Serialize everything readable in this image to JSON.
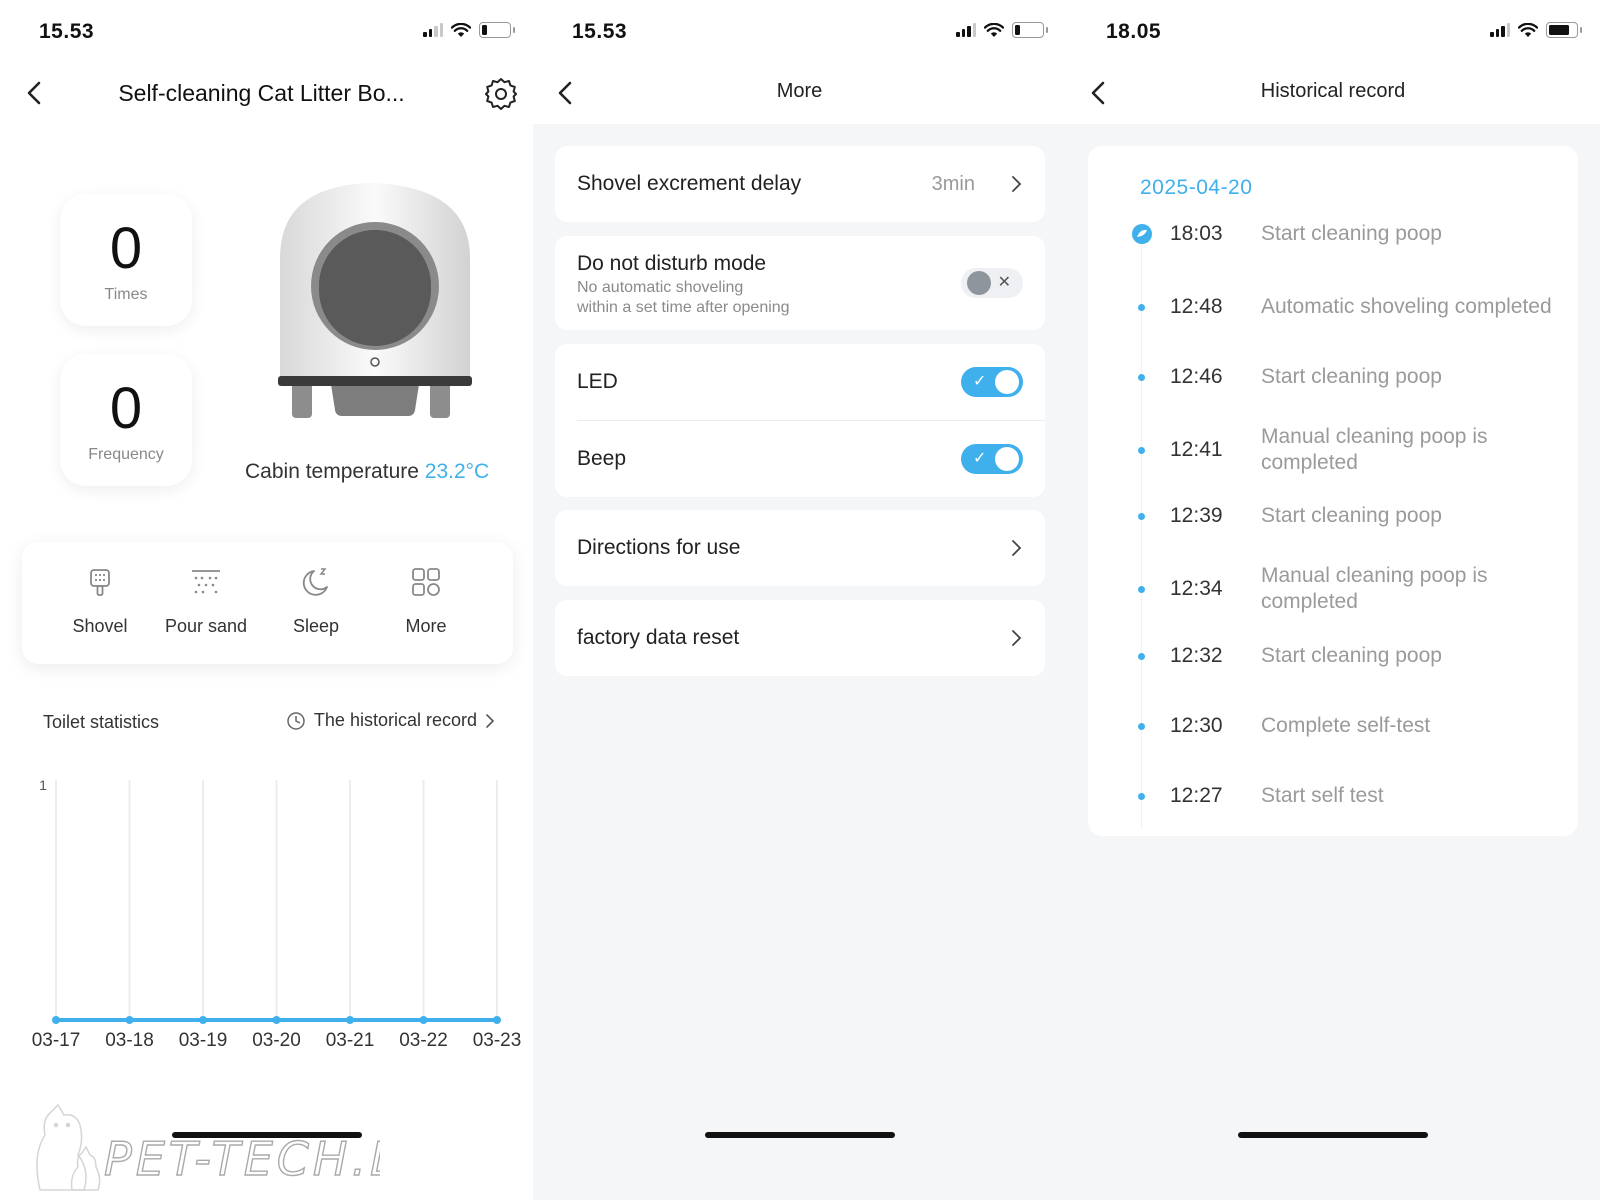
{
  "screen1": {
    "status_time": "15.53",
    "title": "Self-cleaning Cat Litter Bo...",
    "times": {
      "value": "0",
      "label": "Times"
    },
    "frequency": {
      "value": "0",
      "label": "Frequency"
    },
    "cabin_label": "Cabin temperature",
    "cabin_temp": "23.2°C",
    "actions": [
      {
        "label": "Shovel",
        "icon": "shovel-icon"
      },
      {
        "label": "Pour sand",
        "icon": "pour-sand-icon"
      },
      {
        "label": "Sleep",
        "icon": "moon-icon"
      },
      {
        "label": "More",
        "icon": "grid-icon"
      }
    ],
    "stats_title": "Toilet statistics",
    "history_link": "The historical record",
    "watermark": "PET-TECH.DK"
  },
  "chart_data": {
    "type": "line",
    "categories": [
      "03-17",
      "03-18",
      "03-19",
      "03-20",
      "03-21",
      "03-22",
      "03-23"
    ],
    "values": [
      0,
      0,
      0,
      0,
      0,
      0,
      0
    ],
    "ytick": "1",
    "ylim": [
      0,
      1
    ],
    "color": "#3fb0ec"
  },
  "screen2": {
    "status_time": "15.53",
    "title": "More",
    "shovel_delay": {
      "label": "Shovel excrement delay",
      "value": "3min"
    },
    "dnd": {
      "label": "Do not disturb mode",
      "desc1": "No automatic shoveling",
      "desc2": "within a set time after opening",
      "on": false
    },
    "led": {
      "label": "LED",
      "on": true
    },
    "beep": {
      "label": "Beep",
      "on": true
    },
    "directions": "Directions for use",
    "reset": "factory data reset"
  },
  "screen3": {
    "status_time": "18.05",
    "title": "Historical record",
    "date": "2025-04-20",
    "records": [
      {
        "time": "18:03",
        "event": "Start cleaning poop"
      },
      {
        "time": "12:48",
        "event": "Automatic shoveling completed"
      },
      {
        "time": "12:46",
        "event": "Start cleaning poop"
      },
      {
        "time": "12:41",
        "event": "Manual cleaning poop is completed"
      },
      {
        "time": "12:39",
        "event": "Start cleaning poop"
      },
      {
        "time": "12:34",
        "event": "Manual cleaning poop is completed"
      },
      {
        "time": "12:32",
        "event": "Start cleaning poop"
      },
      {
        "time": "12:30",
        "event": "Complete self-test"
      },
      {
        "time": "12:27",
        "event": "Start self test"
      }
    ]
  },
  "colors": {
    "accent": "#3fb0ec",
    "text": "#222222",
    "muted": "#9a9a9a",
    "bg": "#f5f6f8"
  }
}
